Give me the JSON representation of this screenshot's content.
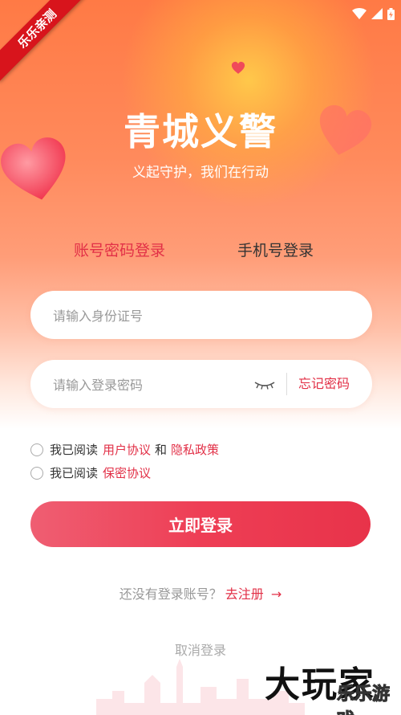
{
  "status_bar": {
    "icons": [
      "wifi-icon",
      "signal-icon",
      "battery-icon"
    ]
  },
  "corner_ribbon": "乐乐亲测",
  "app": {
    "title": "青城义警",
    "slogan": "义起守护，我们在行动"
  },
  "tabs": [
    {
      "label": "账号密码登录",
      "active": true
    },
    {
      "label": "手机号登录",
      "active": false
    }
  ],
  "form": {
    "id_placeholder": "请输入身份证号",
    "password_placeholder": "请输入登录密码",
    "forgot_label": "忘记密码"
  },
  "agreements": {
    "line1_prefix": "我已阅读",
    "user_agreement": "用户协议",
    "and": "和",
    "privacy_policy": "隐私政策",
    "line2_prefix": "我已阅读",
    "confidential_agreement": "保密协议"
  },
  "login_button": "立即登录",
  "register": {
    "prompt": "还没有登录账号？",
    "link": "去注册",
    "arrow": "→"
  },
  "cancel": "取消登录",
  "watermark": {
    "main": "大玩家",
    "sub": "乐乐游戏"
  },
  "colors": {
    "accent": "#e23047",
    "button": "#ee3e55",
    "gradient_top": "#ff7a45"
  }
}
